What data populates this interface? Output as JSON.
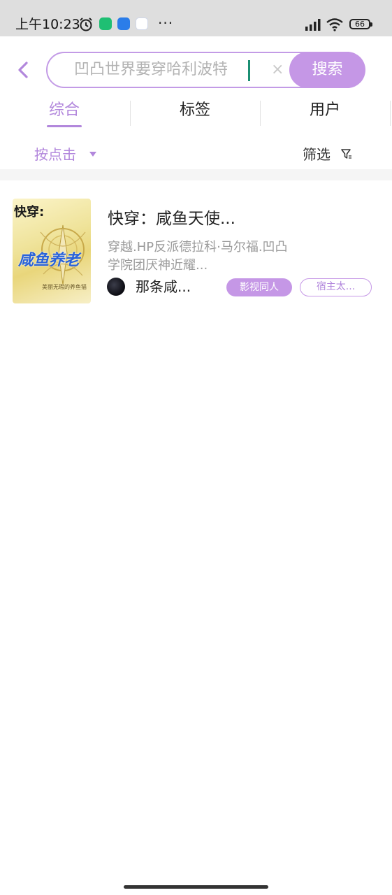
{
  "status_bar": {
    "time": "上午10:23",
    "more": "···",
    "battery": "66",
    "icons": [
      "alarm-icon",
      "app-shield-icon",
      "app-blue-icon",
      "app-calendar-icon",
      "signal-icon",
      "wifi-icon",
      "battery-icon"
    ]
  },
  "search": {
    "query": "凹凸世界要穿哈利波特",
    "clear": "×",
    "button_label": "搜索"
  },
  "tabs": [
    {
      "label": "综合",
      "active": true
    },
    {
      "label": "标签",
      "active": false
    },
    {
      "label": "用户",
      "active": false
    }
  ],
  "sort": {
    "label": "按点击"
  },
  "filter": {
    "label": "筛选"
  },
  "results": [
    {
      "title": "快穿：咸鱼天使...",
      "description": "穿越.HP反派德拉科·马尔福.凹凸学院团厌神近耀...",
      "author": "那条咸...",
      "tags": [
        "影视同人",
        "宿主太..."
      ],
      "cover": {
        "title": "快穿:",
        "main": "咸鱼养老",
        "sub": "美丽无瑕的养鱼猫"
      }
    }
  ],
  "colors": {
    "accent": "#c597e6",
    "accent_text": "#b287dc",
    "status_bar_bg": "#dedede"
  }
}
